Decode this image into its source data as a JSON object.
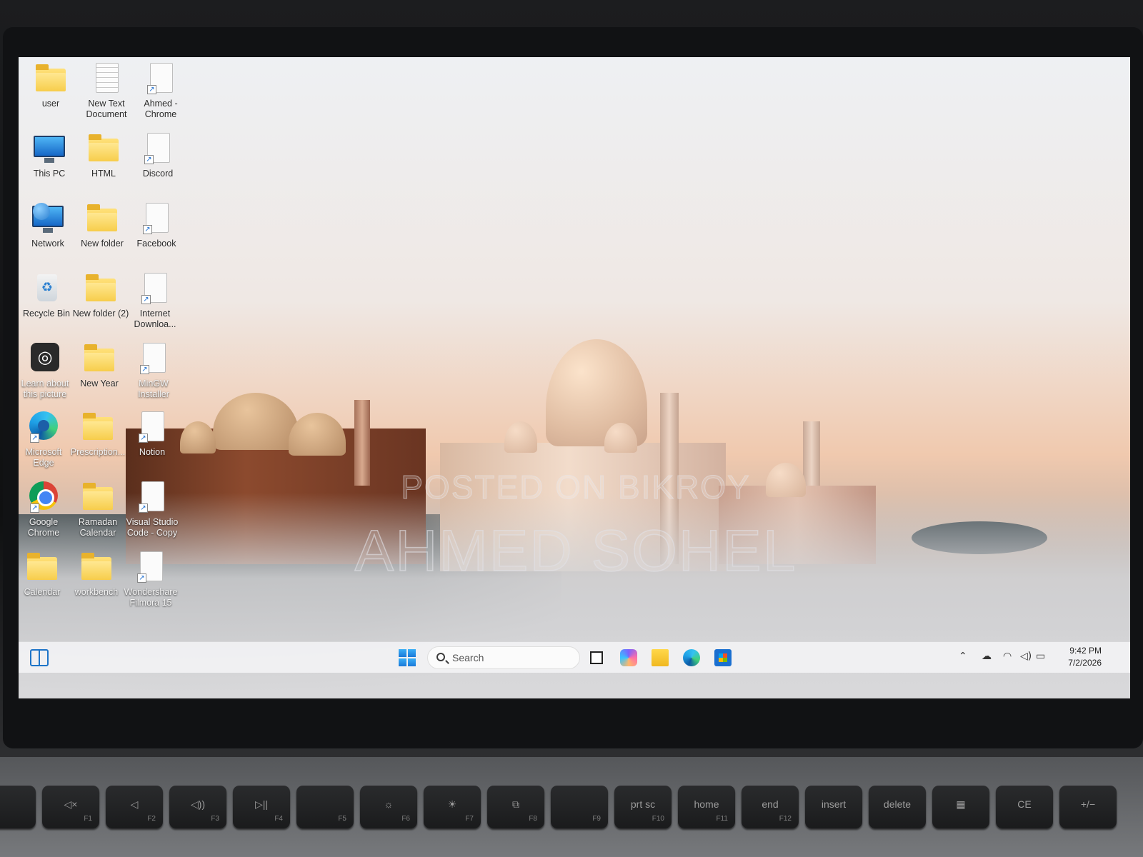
{
  "desktop": {
    "icons": [
      {
        "label": "user"
      },
      {
        "label": "New Text Document"
      },
      {
        "label": "Ahmed - Chrome"
      },
      {
        "label": "This PC"
      },
      {
        "label": "HTML"
      },
      {
        "label": "Discord"
      },
      {
        "label": "Network"
      },
      {
        "label": "New folder"
      },
      {
        "label": "Facebook"
      },
      {
        "label": "Recycle Bin"
      },
      {
        "label": "New folder (2)"
      },
      {
        "label": "Internet Downloa..."
      },
      {
        "label": "Learn about this picture"
      },
      {
        "label": "New Year"
      },
      {
        "label": "MinGW Installer"
      },
      {
        "label": "Microsoft Edge"
      },
      {
        "label": "Prescription..."
      },
      {
        "label": "Notion"
      },
      {
        "label": "Google Chrome"
      },
      {
        "label": "Ramadan Calendar"
      },
      {
        "label": "Visual Studio Code - Copy"
      },
      {
        "label": "Calendar"
      },
      {
        "label": "workbench"
      },
      {
        "label": "Wondershare Filmora 15"
      }
    ]
  },
  "watermark": {
    "line1": "POSTED ON BIKROY",
    "line2": "AHMED SOHEL"
  },
  "taskbar": {
    "search_placeholder": "Search",
    "tray": {
      "overflow_icon": "chevron-up-icon",
      "cloud_icon": "onedrive-icon",
      "wifi_icon": "wifi-icon",
      "volume_icon": "volume-icon",
      "battery_icon": "battery-icon"
    },
    "clock": {
      "time": "9:42 PM",
      "date": "7/2/2026"
    }
  },
  "keyboard": {
    "keys": [
      {
        "label": "",
        "fn": ""
      },
      {
        "label": "◁×",
        "fn": "F1"
      },
      {
        "label": "◁",
        "fn": "F2"
      },
      {
        "label": "◁))",
        "fn": "F3"
      },
      {
        "label": "▷||",
        "fn": "F4"
      },
      {
        "label": "",
        "fn": "F5"
      },
      {
        "label": "☼",
        "fn": "F6"
      },
      {
        "label": "☀",
        "fn": "F7"
      },
      {
        "label": "⧉",
        "fn": "F8"
      },
      {
        "label": "",
        "fn": "F9"
      },
      {
        "label": "prt sc",
        "fn": "F10"
      },
      {
        "label": "home",
        "fn": "F11"
      },
      {
        "label": "end",
        "fn": "F12"
      },
      {
        "label": "insert",
        "fn": ""
      },
      {
        "label": "delete",
        "fn": ""
      },
      {
        "label": "▦",
        "fn": ""
      },
      {
        "label": "CE",
        "fn": ""
      },
      {
        "label": "+/−",
        "fn": ""
      }
    ]
  },
  "colors": {
    "accent": "#1d74c8",
    "folder": "#f2c23c"
  }
}
